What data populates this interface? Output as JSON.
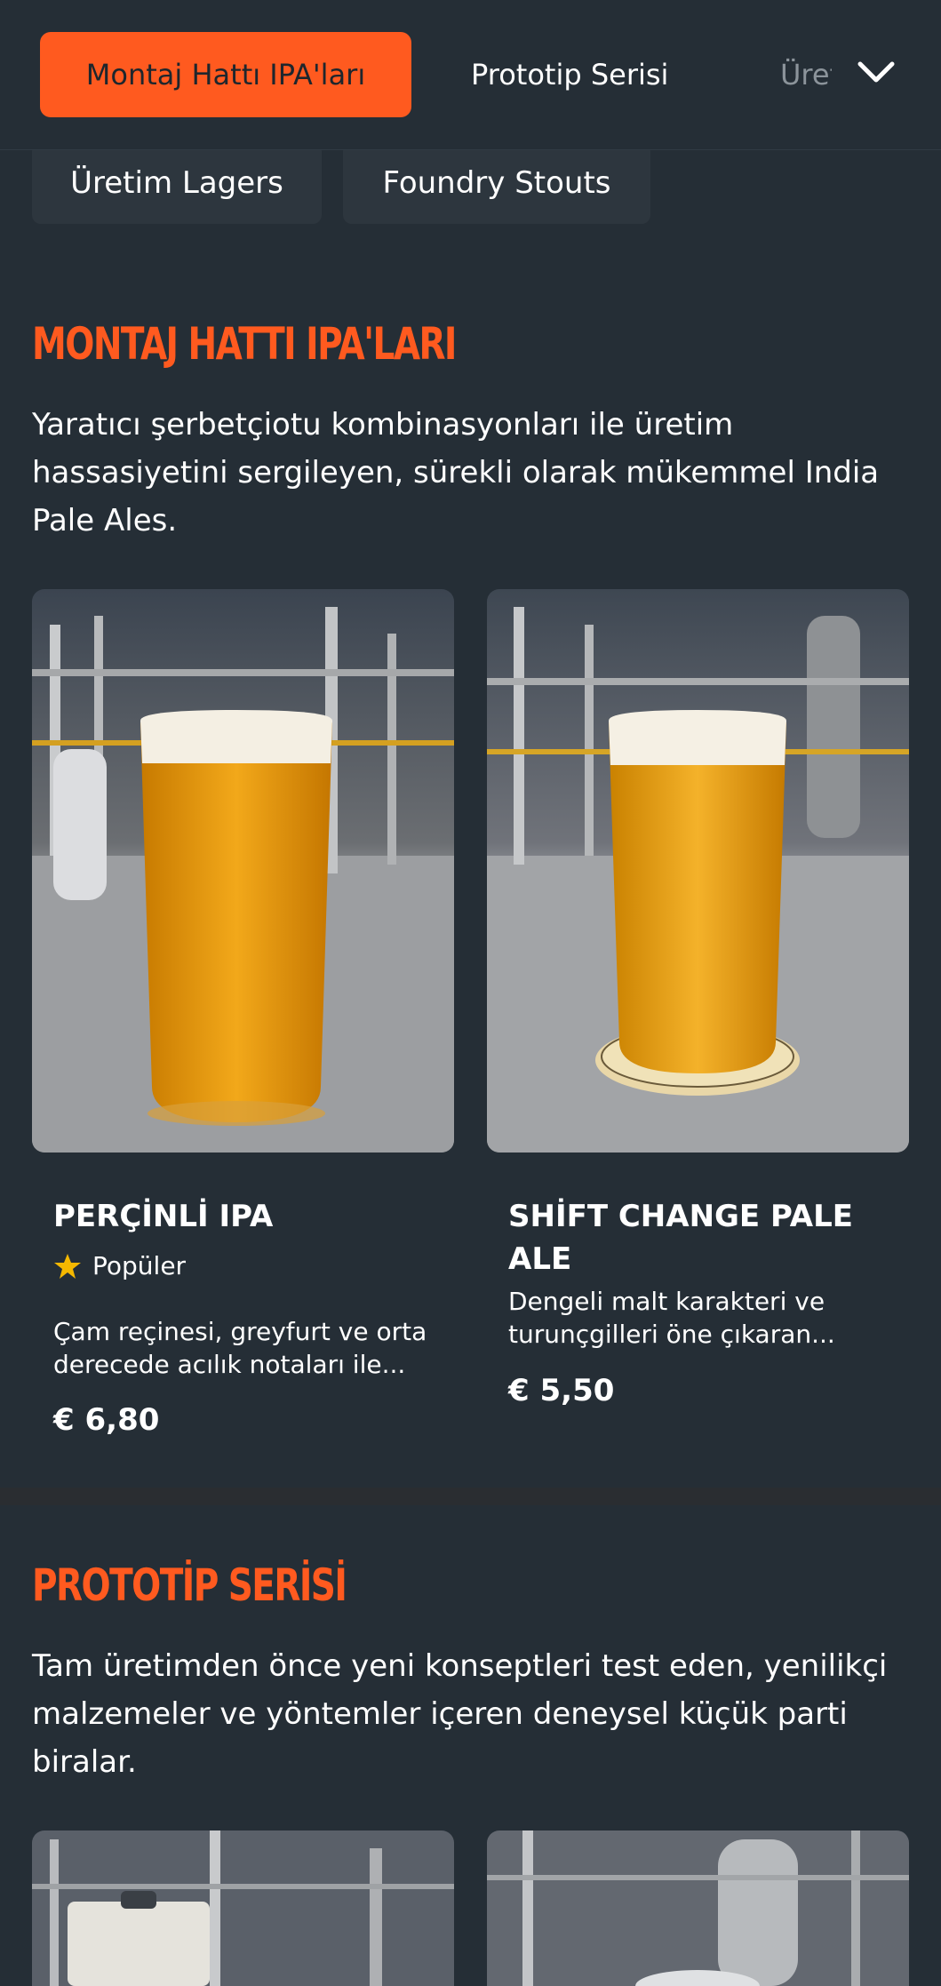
{
  "tabs": {
    "active": "Montaj Hattı IPA'ları",
    "second": "Prototip Serisi",
    "third_partial": "Üretim Lagers"
  },
  "chips": [
    "Üretim Lagers",
    "Foundry Stouts"
  ],
  "sections": [
    {
      "title": "MONTAJ HATTI IPA'LARI",
      "description": "Yaratıcı şerbetçiotu kombinasyonları ile üretim hassasiyetini sergileyen, sürekli olarak mükemmel India Pale Ales.",
      "products": [
        {
          "name": "PERÇİNLİ IPA",
          "badge": "Popüler",
          "description": "Çam reçinesi, greyfurt ve orta derecede acılık notaları ile...",
          "price": "€ 6,80"
        },
        {
          "name": "SHİFT CHANGE PALE ALE",
          "description": "Dengeli malt karakteri ve turunçgilleri öne çıkaran...",
          "price": "€ 5,50"
        }
      ]
    },
    {
      "title": "PROTOTİP SERİSİ",
      "description": "Tam üretimden önce yeni konseptleri test eden, yenilikçi malzemeler ve yöntemler içeren deneysel küçük parti biralar."
    }
  ],
  "colors": {
    "background": "#252e36",
    "accent": "#ff5a1f",
    "chip": "#2d363e",
    "star": "#f5b800"
  },
  "icons": {
    "chevron": "chevron-down-icon",
    "star": "star-icon"
  }
}
